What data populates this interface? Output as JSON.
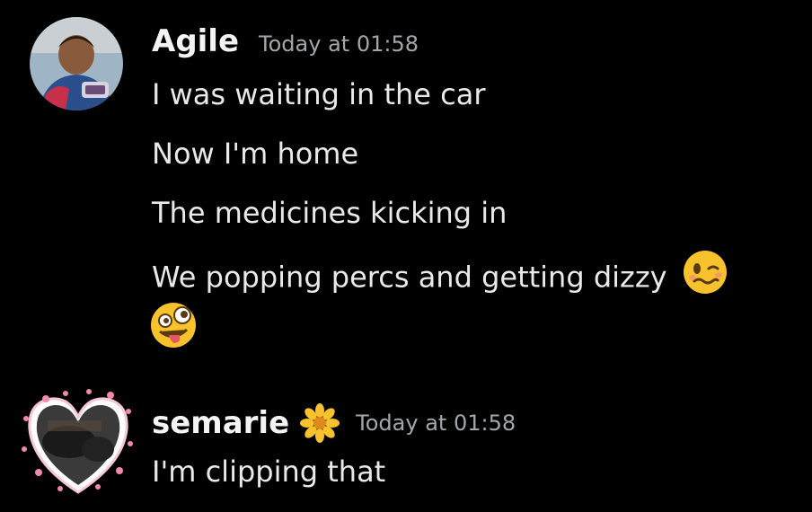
{
  "messages": [
    {
      "author": "Agile",
      "timestamp": "Today at 01:58",
      "lines": [
        "I was waiting in the car",
        "Now I'm home",
        "The medicines kicking in",
        "We popping percs and getting dizzy"
      ],
      "emojis": [
        "woozy-face",
        "zany-face"
      ]
    },
    {
      "author": "semarie",
      "author_badge": "blossom-flower",
      "timestamp": "Today at 01:58",
      "lines": [
        "I'm clipping that"
      ]
    }
  ],
  "colors": {
    "background": "#000000",
    "username": "#f4f4f5",
    "timestamp": "#a3a6aa",
    "text": "#e9e9ea",
    "emoji_yellow": "#f7c22c"
  }
}
